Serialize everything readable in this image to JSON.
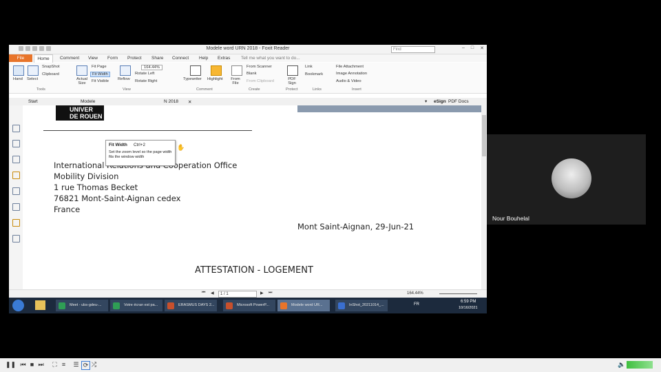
{
  "window": {
    "title": "Modele word URN 2018 - Foxit Reader",
    "search_placeholder": "Find"
  },
  "menubar": {
    "file": "File",
    "tabs": [
      "Home",
      "Comment",
      "View",
      "Form",
      "Protect",
      "Share",
      "Connect",
      "Help",
      "Extras"
    ],
    "tell_me": "Tell me what you want to do..."
  },
  "ribbon": {
    "hand": "Hand",
    "select": "Select",
    "snapshot": "SnapShot",
    "clipboard": "Clipboard",
    "actual_size": "Actual Size",
    "fit_page": "Fit Page",
    "fit_width": "Fit Width",
    "fit_visible": "Fit Visible",
    "reflow": "Reflow",
    "zoom_value": "164.44%",
    "rotate_left": "Rotate Left",
    "rotate_right": "Rotate Right",
    "typewriter": "Typewriter",
    "highlight": "Highlight",
    "from_file": "From File",
    "from_scanner": "From Scanner",
    "blank": "Blank",
    "from_clipboard": "From Clipboard",
    "pdf_sign": "PDF Sign",
    "link": "Link",
    "bookmark": "Bookmark",
    "file_attachment": "File Attachment",
    "image_annotation": "Image Annotation",
    "audio_video": "Audio & Video",
    "groups": {
      "tools": "Tools",
      "view": "View",
      "comment": "Comment",
      "create": "Create",
      "protect": "Protect",
      "links": "Links",
      "insert": "Insert"
    }
  },
  "doc_tabs": {
    "start": "Start",
    "modele": "Modele",
    "second_tab_suffix": "N 2018",
    "esign": "eSign",
    "pdf_docs": "PDF Docs"
  },
  "tooltip": {
    "title": "Fit Width",
    "shortcut": "Ctrl+2",
    "body": "Set the zoom level so the page width fits the window width"
  },
  "document": {
    "address": [
      "International Relations and Cooperation Office",
      "Mobility Division",
      "1 rue Thomas Becket",
      "76821 Mont-Saint-Aignan cedex",
      "France"
    ],
    "date_line": "Mont Saint-Aignan, 29-Jun-21",
    "heading": "ATTESTATION - LOGEMENT",
    "logo_text_1": "UNIVER",
    "logo_text_2": "DE ROUEN"
  },
  "statusbar": {
    "page": "1 / 1",
    "zoom": "164.44%"
  },
  "taskbar": {
    "items": [
      "Meet - ubs-gdeu-...",
      "Votre écran est pa...",
      "ERASMUS DAYS 2...",
      "Microsoft PowerP...",
      "Modele word UR...",
      "InShot_20211014_..."
    ],
    "lang": "FR",
    "time": "6:59 PM",
    "date": "10/16/2021"
  },
  "participant": {
    "name": "Nour Bouhelal"
  },
  "colors": {
    "foxit_orange": "#e8742a",
    "taskbar": "#1c2a3d"
  }
}
